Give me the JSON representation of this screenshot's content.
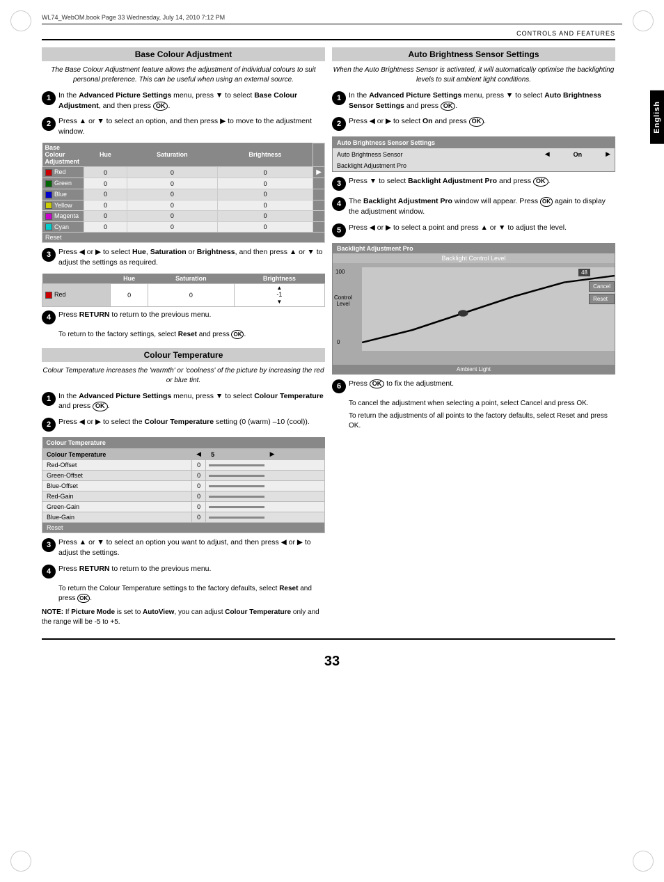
{
  "header": {
    "file_info": "WL74_WebOM.book  Page 33  Wednesday, July 14, 2010  7:12 PM"
  },
  "section_header": "CONTROLS AND FEATURES",
  "language_tab": "English",
  "left_column": {
    "base_colour_adjustment": {
      "title": "Base Colour Adjustment",
      "intro": "The Base Colour Adjustment feature allows the adjustment of individual colours to suit personal preference. This can be useful when using an external source.",
      "steps": [
        {
          "num": "1",
          "text": "In the Advanced Picture Settings menu, press ▼ to select Base Colour Adjustment, and then press OK."
        },
        {
          "num": "2",
          "text": "Press ▲ or ▼ to select an option, and then press ▶ to move to the adjustment window."
        },
        {
          "num": "3",
          "text": "Press ◀ or ▶ to select Hue, Saturation or Brightness, and then press ▲ or ▼ to adjust the settings as required."
        },
        {
          "num": "4",
          "text": "Press RETURN to return to the previous menu."
        }
      ],
      "sub_text_4": "To return to the factory settings, select Reset and press OK.",
      "table": {
        "headers": [
          "",
          "Hue",
          "Saturation",
          "Brightness"
        ],
        "rows": [
          {
            "label": "Red",
            "color": "#cc0000",
            "hue": "0",
            "sat": "0",
            "bright": "0"
          },
          {
            "label": "Green",
            "color": "#006600",
            "hue": "0",
            "sat": "0",
            "bright": "0"
          },
          {
            "label": "Blue",
            "color": "#0000cc",
            "hue": "0",
            "sat": "0",
            "bright": "0"
          },
          {
            "label": "Yellow",
            "color": "#cccc00",
            "hue": "0",
            "sat": "0",
            "bright": "0"
          },
          {
            "label": "Magenta",
            "color": "#cc00cc",
            "hue": "0",
            "sat": "0",
            "bright": "0"
          },
          {
            "label": "Cyan",
            "color": "#00cccc",
            "hue": "0",
            "sat": "0",
            "bright": "0"
          }
        ],
        "reset_label": "Reset"
      },
      "mini_table": {
        "headers": [
          "",
          "Hue",
          "Saturation",
          "Brightness"
        ],
        "row_label": "Red",
        "row_color": "#cc0000",
        "hue": "0",
        "sat": "0",
        "bright": "-1"
      }
    },
    "colour_temperature": {
      "title": "Colour Temperature",
      "intro": "Colour Temperature increases the 'warmth' or 'coolness' of the picture by increasing the red or blue tint.",
      "steps": [
        {
          "num": "1",
          "text": "In the Advanced Picture Settings menu, press ▼ to select Colour Temperature and press OK."
        },
        {
          "num": "2",
          "text": "Press ◀ or ▶ to select the Colour Temperature setting (0 (warm) –10 (cool))."
        }
      ],
      "ct_table": {
        "header": "Colour Temperature",
        "rows": [
          {
            "label": "Colour Temperature",
            "value": "5",
            "has_arrows": true
          },
          {
            "label": "Red-Offset",
            "value": "0"
          },
          {
            "label": "Green-Offset",
            "value": "0"
          },
          {
            "label": "Blue-Offset",
            "value": "0"
          },
          {
            "label": "Red-Gain",
            "value": "0"
          },
          {
            "label": "Green-Gain",
            "value": "0"
          },
          {
            "label": "Blue-Gain",
            "value": "0"
          },
          {
            "label": "Reset",
            "value": "",
            "is_reset": true
          }
        ]
      },
      "steps_cont": [
        {
          "num": "3",
          "text": "Press ▲ or ▼ to select an option you want to adjust, and then press ◀ or ▶ to adjust the settings."
        },
        {
          "num": "4",
          "text": "Press RETURN to return to the previous menu."
        }
      ],
      "sub_text_1": "To return the Colour Temperature settings to the factory defaults, select Reset and press OK.",
      "note": "NOTE: If Picture Mode is set to AutoView, you can adjust Colour Temperature only and the range will be -5 to +5."
    }
  },
  "right_column": {
    "auto_brightness_sensor": {
      "title": "Auto Brightness Sensor Settings",
      "intro": "When the Auto Brightness Sensor is activated, it will automatically optimise the backlighting levels to suit ambient light conditions.",
      "steps": [
        {
          "num": "1",
          "text": "In the Advanced Picture Settings menu, press ▼ to select Auto Brightness Sensor Settings and press OK."
        },
        {
          "num": "2",
          "text": "Press ◀ or ▶ to select On and press OK."
        },
        {
          "num": "3",
          "text": "Press ▼ to select Backlight Adjustment Pro and press OK."
        },
        {
          "num": "4",
          "text": "The Backlight Adjustment Pro window will appear. Press OK again to display the adjustment window."
        },
        {
          "num": "5",
          "text": "Press ◀ or ▶ to select a point and press ▲ or ▼ to adjust the level."
        },
        {
          "num": "6",
          "text": "Press OK to fix the adjustment."
        }
      ],
      "abs_table": {
        "header": "Auto Brightness Sensor Settings",
        "row1_label": "Auto Brightness Sensor",
        "row1_value": "On",
        "row2_label": "Backlight Adjustment Pro"
      },
      "backlight_chart": {
        "title": "Backlight Adjustment Pro",
        "subtitle": "Backlight Control Level",
        "value_48": "48",
        "label_100": "100",
        "label_0": "0",
        "control_level": "Control\nLevel",
        "ambient_light": "Ambient Light",
        "cancel_btn": "Cancel",
        "reset_btn": "Reset"
      },
      "sub_text_cancel": "To cancel the adjustment when selecting a point, select Cancel and press OK.",
      "sub_text_reset": "To return the adjustments of all points to the factory defaults, select Reset and press OK."
    }
  },
  "page_number": "33"
}
